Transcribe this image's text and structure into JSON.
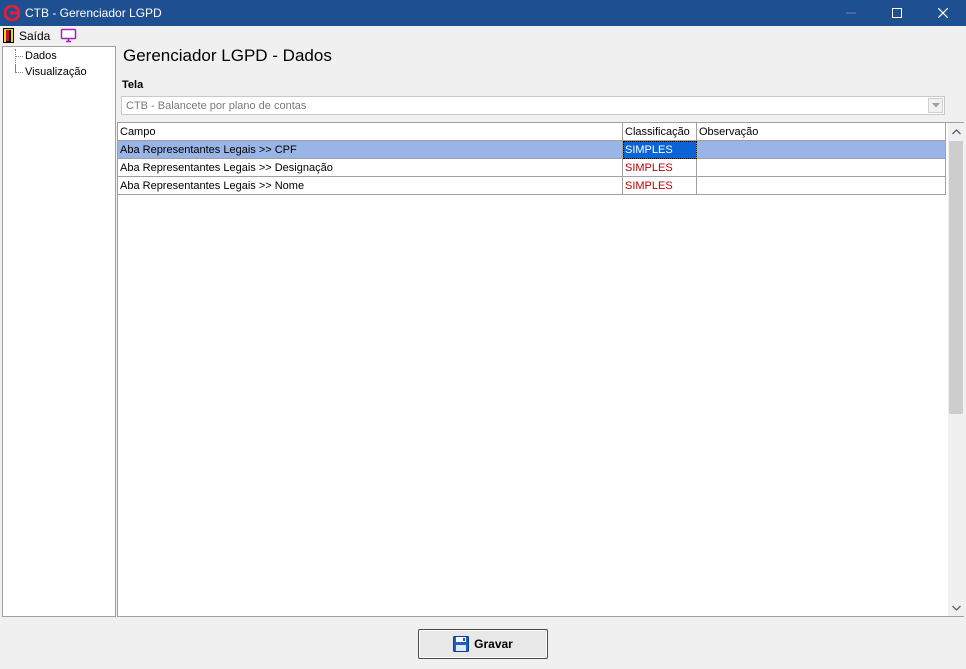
{
  "window": {
    "title": "CTB - Gerenciador LGPD",
    "accent_color": "#1d4f91"
  },
  "menu": {
    "exit_label": "Saída",
    "exit_icon": "door-exit-icon",
    "screen_icon": "monitor-icon"
  },
  "tree": {
    "items": [
      {
        "label": "Dados"
      },
      {
        "label": "Visualização"
      }
    ]
  },
  "main": {
    "title": "Gerenciador LGPD - Dados",
    "screen_label": "Tela",
    "screen_value": "CTB - Balancete por plano de contas"
  },
  "grid": {
    "columns": [
      "Campo",
      "Classificação",
      "Observação"
    ],
    "rows": [
      {
        "campo": "Aba Representantes Legais >> CPF",
        "classificacao": "SIMPLES",
        "observacao": "",
        "selected": true
      },
      {
        "campo": "Aba Representantes Legais >> Designação",
        "classificacao": "SIMPLES",
        "observacao": ""
      },
      {
        "campo": "Aba Representantes Legais >> Nome",
        "classificacao": "SIMPLES",
        "observacao": ""
      }
    ],
    "classification_color": "#c00000",
    "selection_color": "#99b4e6"
  },
  "footer": {
    "save_label": "Gravar",
    "save_icon": "floppy-disk-icon"
  }
}
